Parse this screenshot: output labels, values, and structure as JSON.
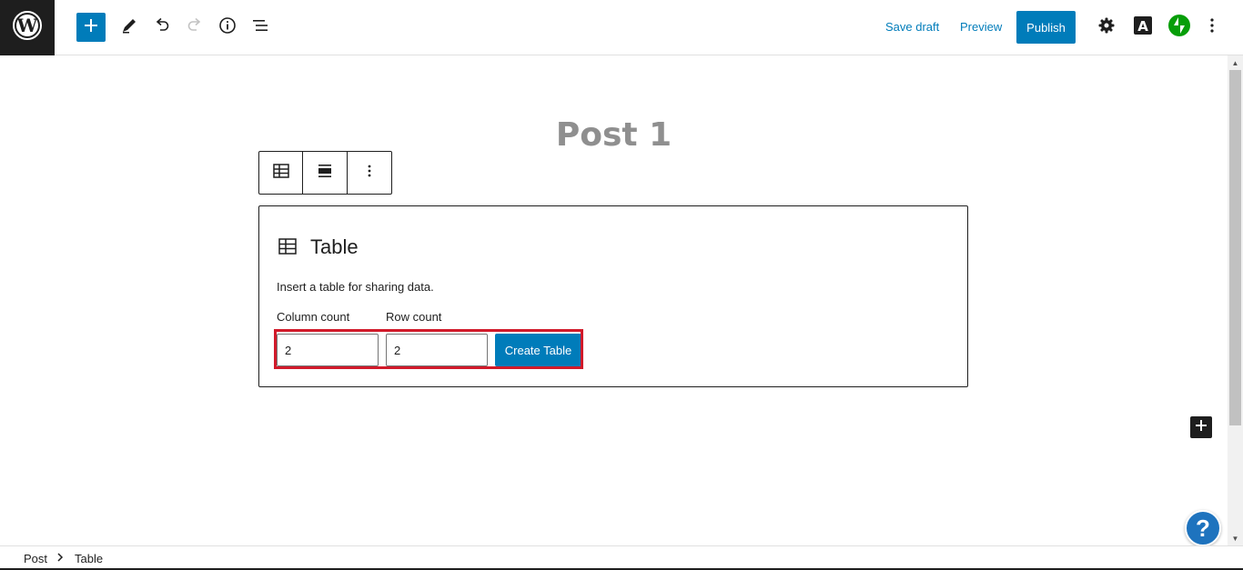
{
  "topbar": {
    "save_draft": "Save draft",
    "preview": "Preview",
    "publish": "Publish",
    "accent_color": "#007cba",
    "jetpack_color": "#069e08"
  },
  "post": {
    "title": "Post 1"
  },
  "table_block": {
    "label": "Table",
    "instructions": "Insert a table for sharing data.",
    "column_label": "Column count",
    "row_label": "Row count",
    "column_value": "2",
    "row_value": "2",
    "create_label": "Create Table"
  },
  "help": {
    "label": "?"
  },
  "breadcrumb": {
    "items": [
      "Post",
      "Table"
    ]
  }
}
